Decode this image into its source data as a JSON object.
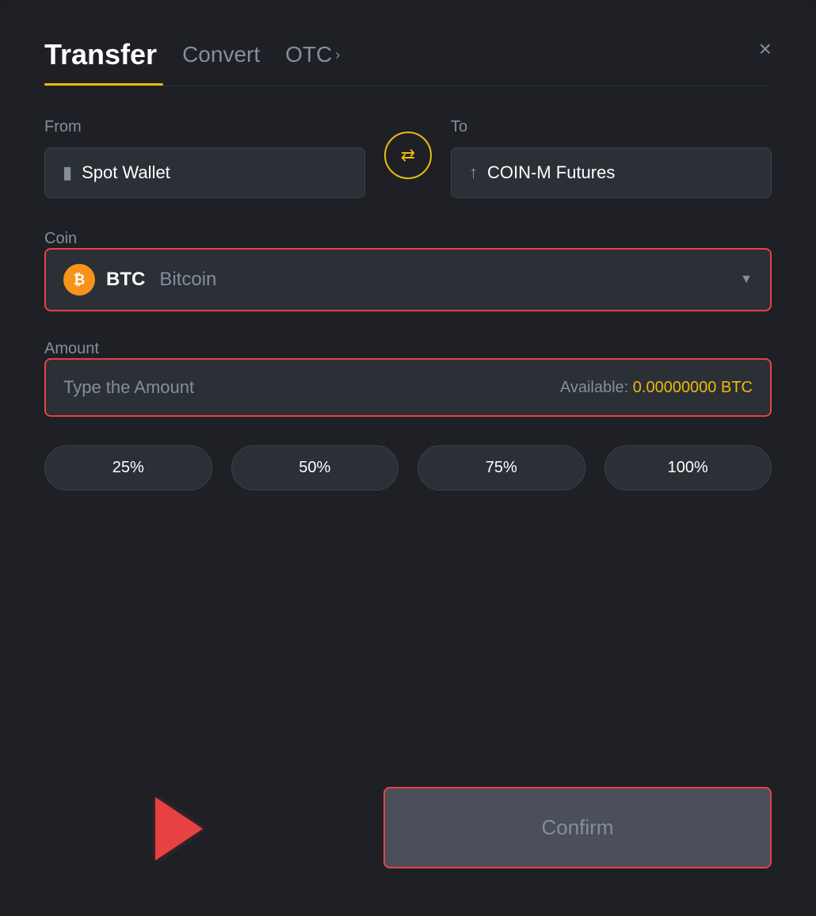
{
  "header": {
    "title": "Transfer",
    "tab_convert": "Convert",
    "tab_otc": "OTC",
    "close_label": "×"
  },
  "from": {
    "label": "From",
    "wallet_icon": "💳",
    "wallet_name": "Spot Wallet"
  },
  "swap": {
    "icon": "⇄"
  },
  "to": {
    "label": "To",
    "wallet_icon": "↑",
    "wallet_name": "COIN-M Futures"
  },
  "coin": {
    "label": "Coin",
    "symbol": "BTC",
    "name": "Bitcoin",
    "chevron": "▼"
  },
  "amount": {
    "label": "Amount",
    "placeholder": "Type the Amount",
    "available_label": "Available:",
    "available_value": "0.00000000 BTC"
  },
  "percent_buttons": [
    "25%",
    "50%",
    "75%",
    "100%"
  ],
  "confirm_button": "Confirm"
}
